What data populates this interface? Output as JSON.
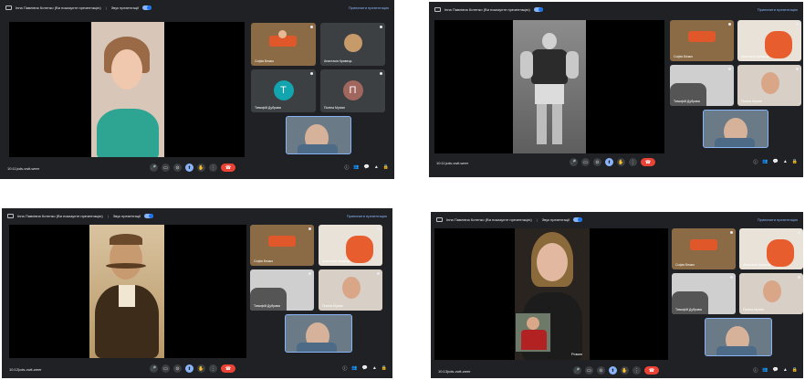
{
  "common": {
    "presenter_title": "Інна Павлівна Котенко (Ви показуєте презентацію)",
    "sound_label": "Звук презентації",
    "stop_label": "Припинити презентацію",
    "meeting_code": "cds-vwit-weer"
  },
  "quads": [
    {
      "time": "10:11",
      "tiles": [
        {
          "name": "Софія Бежко"
        },
        {
          "name": "Анастасія Кравець"
        },
        {
          "name": "Тимофій Дубрава",
          "initial": "T",
          "color": "#12a4af"
        },
        {
          "name": "Поліна Мусіян",
          "initial": "П",
          "color": "#a1665e"
        }
      ]
    },
    {
      "time": "10:11",
      "tiles": [
        {
          "name": "Софія Бежко"
        },
        {
          "name": "Анастасія Кравець"
        },
        {
          "name": "Тимофій Дубрава"
        },
        {
          "name": "Поліна Мусіян"
        }
      ]
    },
    {
      "time": "10:12",
      "tiles": [
        {
          "name": "Софія Бежко"
        },
        {
          "name": "Анастасія Кравець"
        },
        {
          "name": "Тимофій Дубрава"
        },
        {
          "name": "Поліна Мусіян"
        }
      ]
    },
    {
      "time": "10:13",
      "stage_caption": "Роман",
      "tiles": [
        {
          "name": "Софія Бежко"
        },
        {
          "name": "Анастасія Кравець"
        },
        {
          "name": "Тимофій Дубрава"
        },
        {
          "name": "Поліна Мусіян"
        }
      ]
    }
  ],
  "icons": {
    "mic": "🎤",
    "cam": "▭",
    "cc": "⊙",
    "present": "⬆",
    "hand": "✋",
    "more": "⋮",
    "hangup": "☎",
    "info": "ⓘ",
    "people": "👥",
    "chat": "💬",
    "activities": "▲",
    "lock": "🔒"
  },
  "colors": {
    "bg": "#202124",
    "accent": "#8ab4f8",
    "hangup": "#ea4335"
  }
}
